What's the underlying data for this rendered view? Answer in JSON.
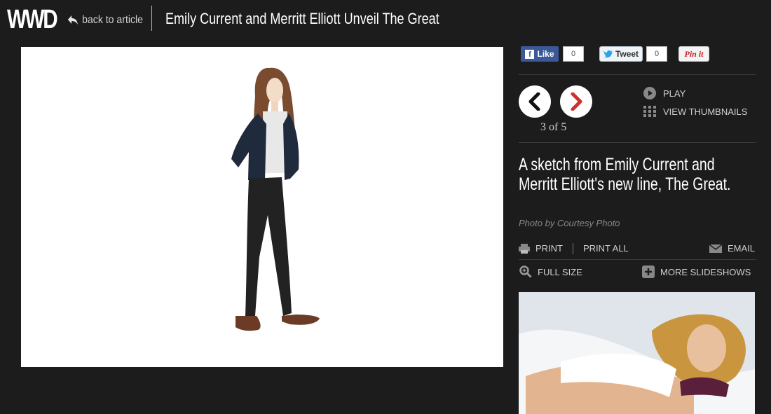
{
  "header": {
    "logo": "WWD",
    "back_label": "back to article",
    "title": "Emily Current and Merritt Elliott Unveil The Great"
  },
  "social": {
    "like_label": "Like",
    "like_count": "0",
    "tweet_label": "Tweet",
    "tweet_count": "0",
    "pin_label": "Pin it"
  },
  "slideshow": {
    "counter": "3 of 5",
    "play_label": "PLAY",
    "thumbnails_label": "VIEW THUMBNAILS",
    "caption": "A sketch from Emily Current and Merritt Elliott's new line, The Great.",
    "credit": "Photo by Courtesy Photo"
  },
  "tools": {
    "print_label": "PRINT",
    "print_all_label": "PRINT ALL",
    "email_label": "EMAIL",
    "full_size_label": "FULL SIZE",
    "more_slideshows_label": "MORE SLIDESHOWS"
  },
  "icons": {
    "back": "back-arrow-icon",
    "prev": "chevron-left-icon",
    "next": "chevron-right-icon",
    "play": "play-icon",
    "thumbnails": "grid-icon",
    "print": "printer-icon",
    "email": "envelope-icon",
    "full_size": "magnifier-icon",
    "more": "plus-icon"
  },
  "colors": {
    "background": "#1c1c1c",
    "next_arrow": "#d32f2f",
    "facebook": "#3b5998",
    "pinterest": "#cb2027"
  }
}
